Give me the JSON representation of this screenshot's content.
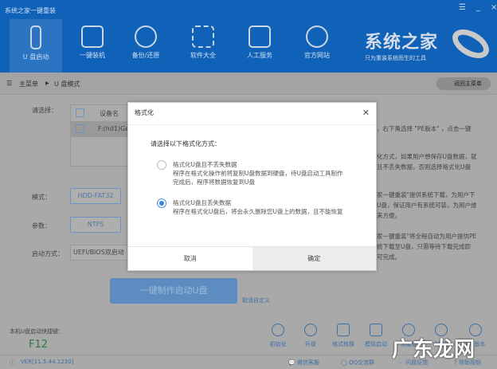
{
  "window": {
    "title": "系统之家一键重装",
    "menu": "☰",
    "minimize": "_",
    "close": "×"
  },
  "nav": [
    {
      "label": "U 盘启动"
    },
    {
      "label": "一键装机"
    },
    {
      "label": "备份/还原"
    },
    {
      "label": "软件大全"
    },
    {
      "label": "人工服务"
    },
    {
      "label": "官方网站"
    }
  ],
  "brand": {
    "name": "系统之家",
    "slogan": "只为重装系统而生的工具"
  },
  "breadcrumb": {
    "home": "主菜单",
    "sep": "▶",
    "current": "U 盘模式",
    "back": "返回主菜单"
  },
  "form": {
    "select_label": "请选择：",
    "device_header": "设备名",
    "device": "F:(hd1)Ge",
    "mode_label": "模式：",
    "mode": "HDD-FAT32",
    "param_label": "参数：",
    "param": "NTFS",
    "boot_label": "启动方式：",
    "boot": "UEFI/BIOS双启动"
  },
  "hints": [
    "，右下角选择 \"PE版本\" ，点击一键",
    "化方式，如果用户想保存U盘数据，就",
    "且不丢失数据，否则选择格式化U盘",
    "家一键重装\"提供系统下载，为用户下",
    "U盘，保证用户有系统可装，为用户维",
    "来方便。",
    "家一键重装\"将全程自动为用户提供PE",
    "统下载至U盘，只需等待下载完成即",
    "可完成。"
  ],
  "make_button": "一键制作启动U盘",
  "cancel_custom": "取消自定义",
  "hotkey": {
    "label": "本机U盘启动快捷键：",
    "value": "F12"
  },
  "tools": [
    {
      "label": "初始化"
    },
    {
      "label": "升级"
    },
    {
      "label": "格式转换"
    },
    {
      "label": "模拟启动"
    },
    {
      "label": "快捷键"
    },
    {
      "label": "个性化"
    },
    {
      "label": "PE 版本"
    }
  ],
  "footer": {
    "version": "VER[11.5.44.1230]",
    "wechat": "微信客服",
    "qq": "QQ交流群",
    "feedback": "问题反馈",
    "help": "帮助视频"
  },
  "dialog": {
    "title": "格式化",
    "prompt": "请选择以下格式化方式：",
    "options": [
      {
        "title": "格式化U盘且不丢失数据",
        "desc1": "程序在格式化操作前将复制U盘数据到硬盘，待U盘启动工具制作",
        "desc2": "完成后，程序将数据恢复到U盘",
        "selected": false
      },
      {
        "title": "格式化U盘且丢失数据",
        "desc1": "程序在格式化U盘后，将会永久删除您U盘上的数据，且不能恢复",
        "selected": true
      }
    ],
    "cancel": "取消",
    "confirm": "确定"
  },
  "watermark": "广东龙网"
}
